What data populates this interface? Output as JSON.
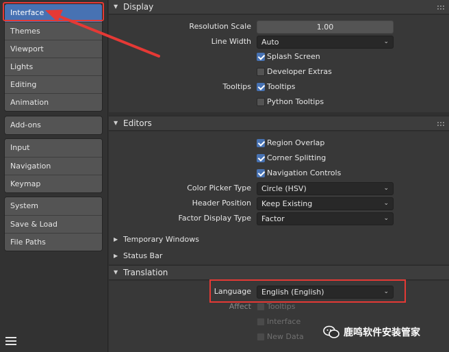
{
  "sidebar": {
    "groups": [
      [
        "Interface",
        "Themes",
        "Viewport",
        "Lights",
        "Editing",
        "Animation"
      ],
      [
        "Add-ons"
      ],
      [
        "Input",
        "Navigation",
        "Keymap"
      ],
      [
        "System",
        "Save & Load",
        "File Paths"
      ]
    ],
    "active": "Interface"
  },
  "display": {
    "title": "Display",
    "resolution_label": "Resolution Scale",
    "resolution_value": "1.00",
    "line_width_label": "Line Width",
    "line_width_value": "Auto",
    "splash_screen": "Splash Screen",
    "developer_extras": "Developer Extras",
    "tooltips_label": "Tooltips",
    "tooltips": "Tooltips",
    "python_tooltips": "Python Tooltips"
  },
  "editors": {
    "title": "Editors",
    "region_overlap": "Region Overlap",
    "corner_splitting": "Corner Splitting",
    "navigation_controls": "Navigation Controls",
    "color_picker_label": "Color Picker Type",
    "color_picker_value": "Circle (HSV)",
    "header_position_label": "Header Position",
    "header_position_value": "Keep Existing",
    "factor_display_label": "Factor Display Type",
    "factor_display_value": "Factor",
    "temporary_windows": "Temporary Windows",
    "status_bar": "Status Bar"
  },
  "translation": {
    "title": "Translation",
    "language_label": "Language",
    "language_value": "English (English)",
    "affect_label": "Affect",
    "tooltips": "Tooltips",
    "interface": "Interface",
    "new_data": "New Data"
  },
  "watermark": {
    "text": "鹿鸣软件安装管家"
  },
  "colors": {
    "accent": "#4772b3",
    "annotation": "#e53935"
  }
}
